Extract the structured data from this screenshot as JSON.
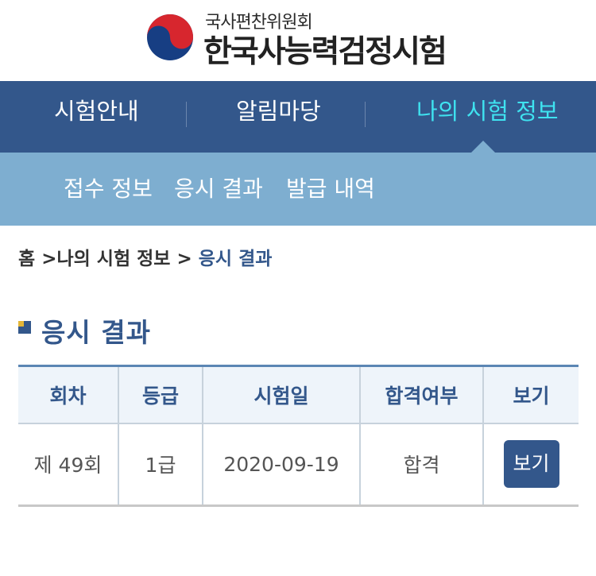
{
  "header": {
    "org_name": "국사편찬위원회",
    "site_title": "한국사능력검정시험",
    "colors": {
      "emblem_red": "#d7262e",
      "emblem_blue": "#173e83"
    }
  },
  "main_nav": {
    "items": [
      {
        "label": "시험안내",
        "active": false
      },
      {
        "label": "알림마당",
        "active": false
      },
      {
        "label": "나의 시험 정보",
        "active": true
      }
    ],
    "colors": {
      "background": "#33578b",
      "active_text": "#3fe3f0"
    }
  },
  "sub_nav": {
    "items": [
      {
        "label": "접수 정보"
      },
      {
        "label": "응시 결과"
      },
      {
        "label": "발급 내역"
      }
    ],
    "colors": {
      "background": "#7eaed0"
    }
  },
  "breadcrumb": {
    "items": [
      "홈",
      "나의 시험 정보",
      "응시 결과"
    ],
    "separator": ">"
  },
  "section": {
    "title": "응시 결과"
  },
  "results_table": {
    "columns": [
      "회차",
      "등급",
      "시험일",
      "합격여부",
      "보기"
    ],
    "rows": [
      {
        "round": "제 49회",
        "grade": "1급",
        "date": "2020-09-19",
        "pass": "합격",
        "view_label": "보기"
      }
    ]
  }
}
